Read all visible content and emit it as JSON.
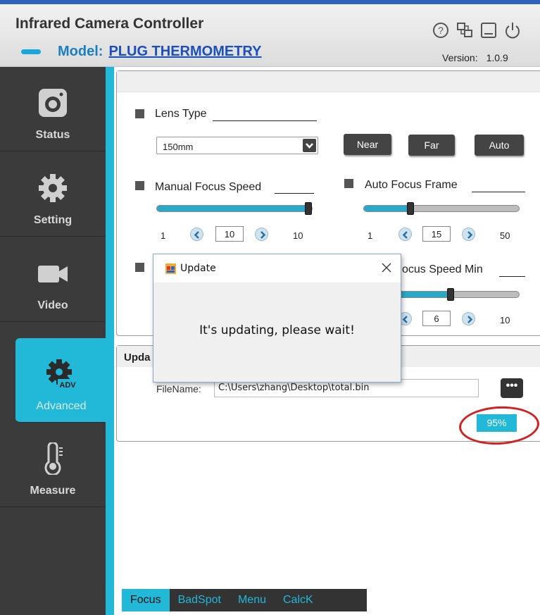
{
  "app": {
    "title": "Infrared Camera Controller",
    "model_label": "Model:",
    "model_value": "PLUG THERMOMETRY",
    "version_label": "Version:",
    "version_value": "1.0.9",
    "header_icons": [
      "help-icon",
      "window-switch-icon",
      "minimize-icon",
      "power-icon"
    ],
    "accent_color": "#22b8d8"
  },
  "sidebar": {
    "items": [
      {
        "label": "Status",
        "icon": "camera-icon"
      },
      {
        "label": "Setting",
        "icon": "gear-icon"
      },
      {
        "label": "Video",
        "icon": "video-camera-icon"
      },
      {
        "label": "Advanced",
        "icon": "gear-adv-icon",
        "icon_text": "ADV",
        "active": true
      },
      {
        "label": "Measure",
        "icon": "thermometer-icon"
      }
    ]
  },
  "focus": {
    "lens_type_label": "Lens Type",
    "lens_value": "150mm",
    "near_label": "Near",
    "far_label": "Far",
    "auto_label": "Auto",
    "manual_focus": {
      "label": "Manual Focus Speed",
      "min": "1",
      "value": "10",
      "max": "10",
      "level": 1.0
    },
    "auto_frame": {
      "label": "Auto Focus Frame",
      "min": "1",
      "value": "15",
      "max": "50",
      "level": 0.29
    },
    "focus_speed_min": {
      "label": "ocus Speed Min",
      "value": "6",
      "max": "10",
      "level": 0.56
    }
  },
  "update": {
    "title": "Upda",
    "filename_label": "FileName:",
    "filename_value": "C:\\Users\\zhang\\Desktop\\total.bin",
    "browse_label": "•••",
    "progress": "95%"
  },
  "tabs": [
    {
      "label": "Focus",
      "active": true
    },
    {
      "label": "BadSpot"
    },
    {
      "label": "Menu"
    },
    {
      "label": "CalcK"
    }
  ],
  "dialog": {
    "title": "Update",
    "message": "It's updating, please wait!",
    "close_glyph": "✕"
  }
}
